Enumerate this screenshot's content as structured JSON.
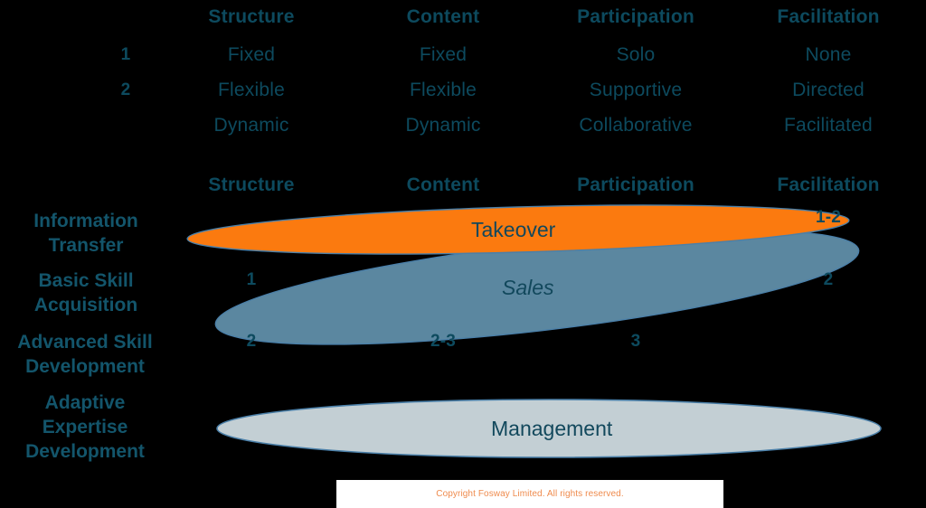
{
  "colors": {
    "background": "#000000",
    "text_teal": "#0d4a5e",
    "heading_teal": "#13556b",
    "takeover_orange": "#fb7a0f",
    "sales_blue": "#5b87a0",
    "management_grey": "#c3cfd4",
    "ellipse_stroke": "#4a7fa8",
    "copyright_orange": "#ef8b4d",
    "strip_background": "#ffffff"
  },
  "legend": {
    "columns": [
      "Structure",
      "Content",
      "Participation",
      "Facilitation"
    ],
    "levels": [
      {
        "number": "1",
        "structure": "Fixed",
        "content": "Fixed",
        "participation": "Solo",
        "facilitation": "None"
      },
      {
        "number": "2",
        "structure": "Flexible",
        "content": "Flexible",
        "participation": "Supportive",
        "facilitation": "Directed"
      },
      {
        "number": "",
        "structure": "Dynamic",
        "content": "Dynamic",
        "participation": "Collaborative",
        "facilitation": "Facilitated"
      }
    ]
  },
  "matrix": {
    "columns": [
      "Structure",
      "Content",
      "Participation",
      "Facilitation"
    ],
    "rows": [
      {
        "label_lines": [
          "Information",
          "Transfer"
        ],
        "band": "Takeover",
        "values": {
          "structure": "",
          "content": "",
          "participation": "",
          "facilitation": "1-2"
        }
      },
      {
        "label_lines": [
          "Basic Skill",
          "Acquisition"
        ],
        "band": "Sales",
        "values": {
          "structure": "1",
          "content": "",
          "participation": "",
          "facilitation": "2"
        }
      },
      {
        "label_lines": [
          "Advanced Skill",
          "Development"
        ],
        "band": "Sales",
        "values": {
          "structure": "2",
          "content": "2-3",
          "participation": "3",
          "facilitation": ""
        }
      },
      {
        "label_lines": [
          "Adaptive",
          "Expertise",
          "Development"
        ],
        "band": "Management",
        "values": {
          "structure": "",
          "content": "",
          "participation": "",
          "facilitation": ""
        }
      }
    ]
  },
  "bands": [
    {
      "name": "Takeover",
      "label": "Takeover",
      "color": "#fb7a0f",
      "italic": false
    },
    {
      "name": "Sales",
      "label": "Sales",
      "color": "#5b87a0",
      "italic": true
    },
    {
      "name": "Management",
      "label": "Management",
      "color": "#c3cfd4",
      "italic": false
    }
  ],
  "footer": {
    "copyright": "Copyright Fosway Limited. All rights reserved."
  }
}
